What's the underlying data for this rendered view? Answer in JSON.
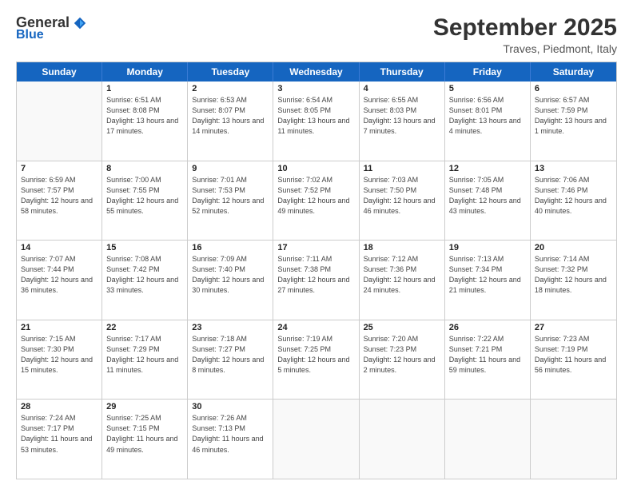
{
  "logo": {
    "general": "General",
    "blue": "Blue"
  },
  "header": {
    "month": "September 2025",
    "location": "Traves, Piedmont, Italy"
  },
  "weekdays": [
    "Sunday",
    "Monday",
    "Tuesday",
    "Wednesday",
    "Thursday",
    "Friday",
    "Saturday"
  ],
  "rows": [
    [
      {
        "day": "",
        "sunrise": "",
        "sunset": "",
        "daylight": ""
      },
      {
        "day": "1",
        "sunrise": "Sunrise: 6:51 AM",
        "sunset": "Sunset: 8:08 PM",
        "daylight": "Daylight: 13 hours and 17 minutes."
      },
      {
        "day": "2",
        "sunrise": "Sunrise: 6:53 AM",
        "sunset": "Sunset: 8:07 PM",
        "daylight": "Daylight: 13 hours and 14 minutes."
      },
      {
        "day": "3",
        "sunrise": "Sunrise: 6:54 AM",
        "sunset": "Sunset: 8:05 PM",
        "daylight": "Daylight: 13 hours and 11 minutes."
      },
      {
        "day": "4",
        "sunrise": "Sunrise: 6:55 AM",
        "sunset": "Sunset: 8:03 PM",
        "daylight": "Daylight: 13 hours and 7 minutes."
      },
      {
        "day": "5",
        "sunrise": "Sunrise: 6:56 AM",
        "sunset": "Sunset: 8:01 PM",
        "daylight": "Daylight: 13 hours and 4 minutes."
      },
      {
        "day": "6",
        "sunrise": "Sunrise: 6:57 AM",
        "sunset": "Sunset: 7:59 PM",
        "daylight": "Daylight: 13 hours and 1 minute."
      }
    ],
    [
      {
        "day": "7",
        "sunrise": "Sunrise: 6:59 AM",
        "sunset": "Sunset: 7:57 PM",
        "daylight": "Daylight: 12 hours and 58 minutes."
      },
      {
        "day": "8",
        "sunrise": "Sunrise: 7:00 AM",
        "sunset": "Sunset: 7:55 PM",
        "daylight": "Daylight: 12 hours and 55 minutes."
      },
      {
        "day": "9",
        "sunrise": "Sunrise: 7:01 AM",
        "sunset": "Sunset: 7:53 PM",
        "daylight": "Daylight: 12 hours and 52 minutes."
      },
      {
        "day": "10",
        "sunrise": "Sunrise: 7:02 AM",
        "sunset": "Sunset: 7:52 PM",
        "daylight": "Daylight: 12 hours and 49 minutes."
      },
      {
        "day": "11",
        "sunrise": "Sunrise: 7:03 AM",
        "sunset": "Sunset: 7:50 PM",
        "daylight": "Daylight: 12 hours and 46 minutes."
      },
      {
        "day": "12",
        "sunrise": "Sunrise: 7:05 AM",
        "sunset": "Sunset: 7:48 PM",
        "daylight": "Daylight: 12 hours and 43 minutes."
      },
      {
        "day": "13",
        "sunrise": "Sunrise: 7:06 AM",
        "sunset": "Sunset: 7:46 PM",
        "daylight": "Daylight: 12 hours and 40 minutes."
      }
    ],
    [
      {
        "day": "14",
        "sunrise": "Sunrise: 7:07 AM",
        "sunset": "Sunset: 7:44 PM",
        "daylight": "Daylight: 12 hours and 36 minutes."
      },
      {
        "day": "15",
        "sunrise": "Sunrise: 7:08 AM",
        "sunset": "Sunset: 7:42 PM",
        "daylight": "Daylight: 12 hours and 33 minutes."
      },
      {
        "day": "16",
        "sunrise": "Sunrise: 7:09 AM",
        "sunset": "Sunset: 7:40 PM",
        "daylight": "Daylight: 12 hours and 30 minutes."
      },
      {
        "day": "17",
        "sunrise": "Sunrise: 7:11 AM",
        "sunset": "Sunset: 7:38 PM",
        "daylight": "Daylight: 12 hours and 27 minutes."
      },
      {
        "day": "18",
        "sunrise": "Sunrise: 7:12 AM",
        "sunset": "Sunset: 7:36 PM",
        "daylight": "Daylight: 12 hours and 24 minutes."
      },
      {
        "day": "19",
        "sunrise": "Sunrise: 7:13 AM",
        "sunset": "Sunset: 7:34 PM",
        "daylight": "Daylight: 12 hours and 21 minutes."
      },
      {
        "day": "20",
        "sunrise": "Sunrise: 7:14 AM",
        "sunset": "Sunset: 7:32 PM",
        "daylight": "Daylight: 12 hours and 18 minutes."
      }
    ],
    [
      {
        "day": "21",
        "sunrise": "Sunrise: 7:15 AM",
        "sunset": "Sunset: 7:30 PM",
        "daylight": "Daylight: 12 hours and 15 minutes."
      },
      {
        "day": "22",
        "sunrise": "Sunrise: 7:17 AM",
        "sunset": "Sunset: 7:29 PM",
        "daylight": "Daylight: 12 hours and 11 minutes."
      },
      {
        "day": "23",
        "sunrise": "Sunrise: 7:18 AM",
        "sunset": "Sunset: 7:27 PM",
        "daylight": "Daylight: 12 hours and 8 minutes."
      },
      {
        "day": "24",
        "sunrise": "Sunrise: 7:19 AM",
        "sunset": "Sunset: 7:25 PM",
        "daylight": "Daylight: 12 hours and 5 minutes."
      },
      {
        "day": "25",
        "sunrise": "Sunrise: 7:20 AM",
        "sunset": "Sunset: 7:23 PM",
        "daylight": "Daylight: 12 hours and 2 minutes."
      },
      {
        "day": "26",
        "sunrise": "Sunrise: 7:22 AM",
        "sunset": "Sunset: 7:21 PM",
        "daylight": "Daylight: 11 hours and 59 minutes."
      },
      {
        "day": "27",
        "sunrise": "Sunrise: 7:23 AM",
        "sunset": "Sunset: 7:19 PM",
        "daylight": "Daylight: 11 hours and 56 minutes."
      }
    ],
    [
      {
        "day": "28",
        "sunrise": "Sunrise: 7:24 AM",
        "sunset": "Sunset: 7:17 PM",
        "daylight": "Daylight: 11 hours and 53 minutes."
      },
      {
        "day": "29",
        "sunrise": "Sunrise: 7:25 AM",
        "sunset": "Sunset: 7:15 PM",
        "daylight": "Daylight: 11 hours and 49 minutes."
      },
      {
        "day": "30",
        "sunrise": "Sunrise: 7:26 AM",
        "sunset": "Sunset: 7:13 PM",
        "daylight": "Daylight: 11 hours and 46 minutes."
      },
      {
        "day": "",
        "sunrise": "",
        "sunset": "",
        "daylight": ""
      },
      {
        "day": "",
        "sunrise": "",
        "sunset": "",
        "daylight": ""
      },
      {
        "day": "",
        "sunrise": "",
        "sunset": "",
        "daylight": ""
      },
      {
        "day": "",
        "sunrise": "",
        "sunset": "",
        "daylight": ""
      }
    ]
  ]
}
